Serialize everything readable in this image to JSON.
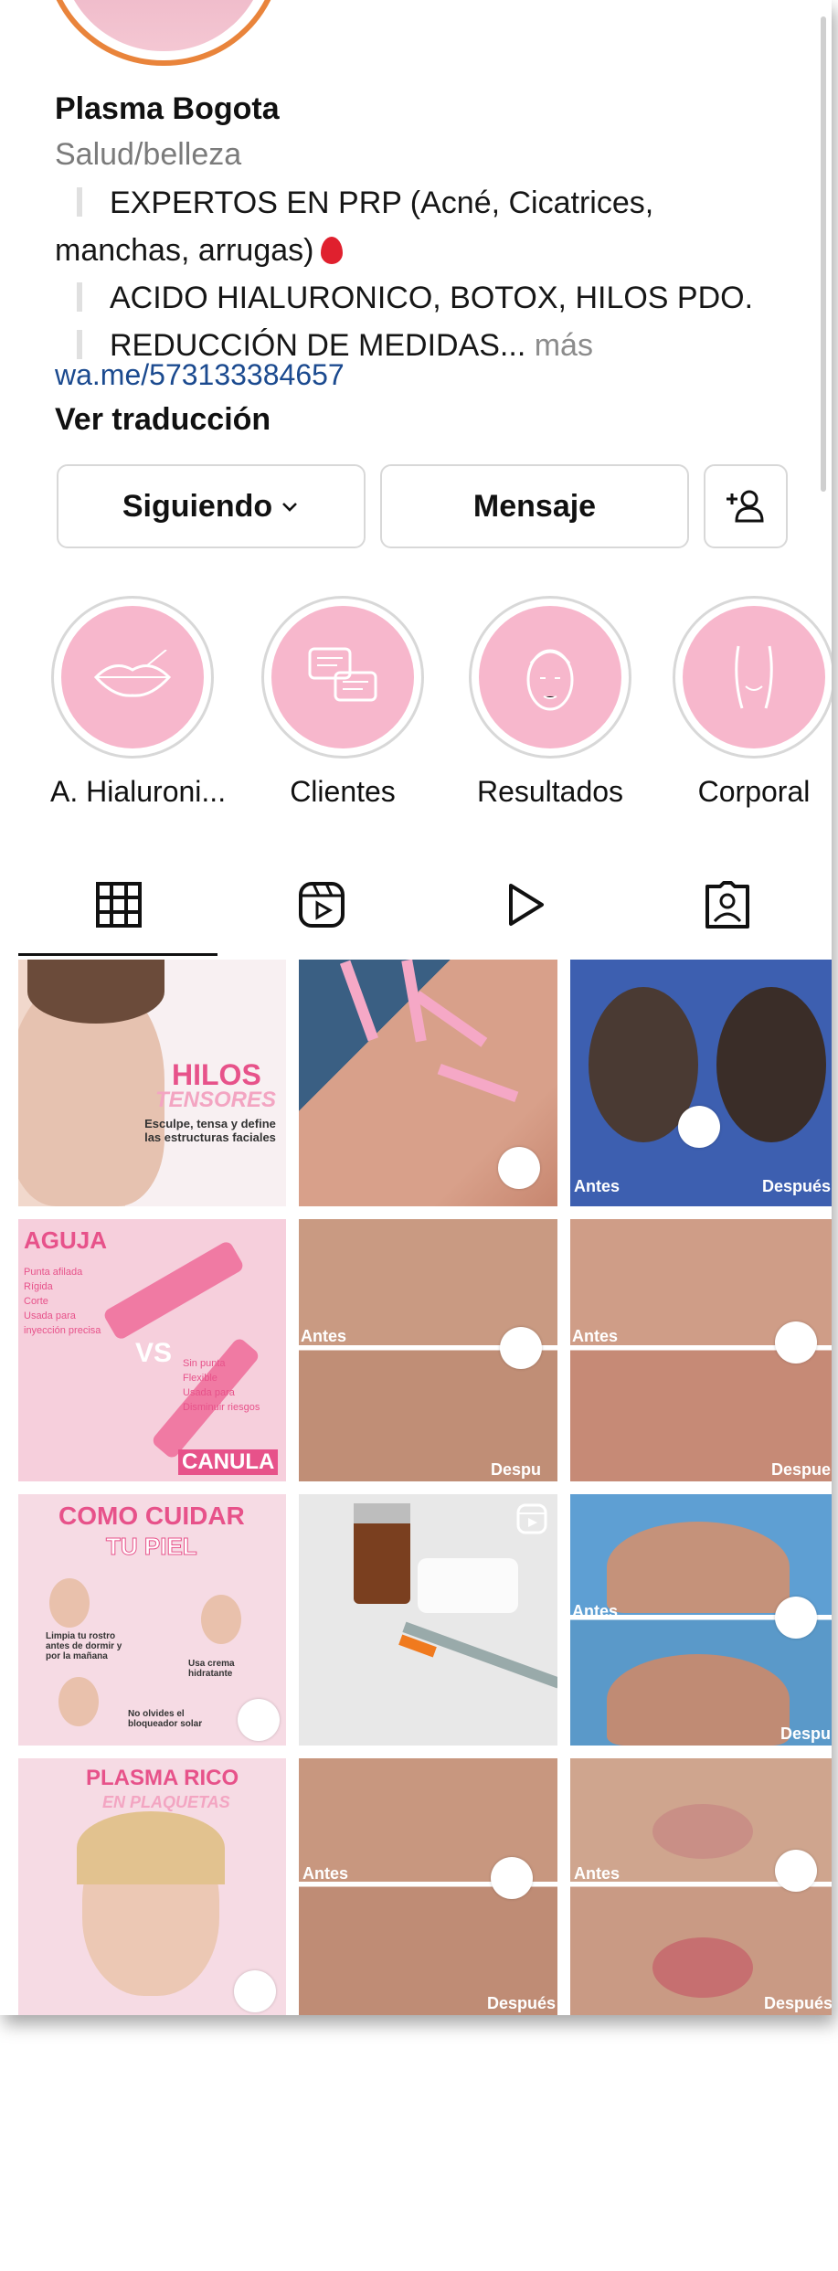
{
  "profile": {
    "name": "Plasma Bogota",
    "category": "Salud/belleza",
    "bio_line1": "EXPERTOS EN PRP (Acné, Cicatrices,",
    "bio_line2": "manchas, arrugas)",
    "bio_line3": "ACIDO HIALURONICO, BOTOX, HILOS PDO.",
    "bio_line4": "REDUCCIÓN DE MEDIDAS...",
    "bio_more": "más",
    "link": "wa.me/573133384657",
    "translate": "Ver traducción"
  },
  "actions": {
    "following": "Siguiendo",
    "message": "Mensaje"
  },
  "highlights": [
    {
      "label": "A. Hialuroni..."
    },
    {
      "label": "Clientes"
    },
    {
      "label": "Resultados"
    },
    {
      "label": "Corporal"
    }
  ],
  "tabs": [
    "grid",
    "reels",
    "video",
    "tagged"
  ],
  "posts": {
    "hilos_title": "HILOS",
    "hilos_sub": "TENSORES",
    "hilos_desc": "Esculpe, tensa y define las estructuras faciales",
    "aguja": "AGUJA",
    "vs": "VS",
    "canula": "CANULA",
    "aguja_points": [
      "Punta afilada",
      "Rígida",
      "Corte",
      "Usada para inyección precisa"
    ],
    "canula_points": [
      "Sin punta",
      "Flexible",
      "Usada para Disminuir riesgos"
    ],
    "como_cuidar": "COMO CUIDAR",
    "tu_piel": "TU PIEL",
    "cuidar_steps": [
      "Limpia tu rostro antes de dormir y por la mañana",
      "Usa crema hidratante",
      "No olvides el bloqueador solar"
    ],
    "plasma_rico": "PLASMA RICO",
    "plasma_sub": "EN PLAQUETAS",
    "antes": "Antes",
    "despues": "Después",
    "despues_cut": "Despue",
    "despues_cut2": "Despu"
  },
  "colors": {
    "pink": "#f7b7cc",
    "accent_pink": "#e7528a",
    "link_blue": "#1b4a8f"
  }
}
